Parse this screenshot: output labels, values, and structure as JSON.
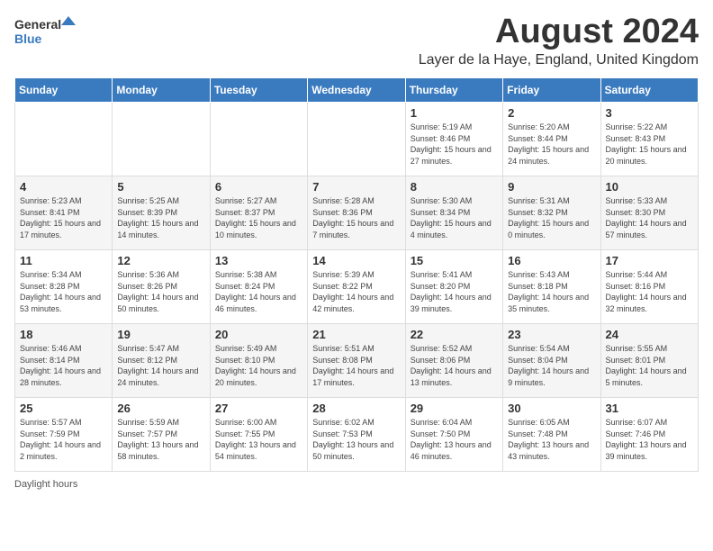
{
  "header": {
    "logo_general": "General",
    "logo_blue": "Blue",
    "month_title": "August 2024",
    "location": "Layer de la Haye, England, United Kingdom"
  },
  "weekdays": [
    "Sunday",
    "Monday",
    "Tuesday",
    "Wednesday",
    "Thursday",
    "Friday",
    "Saturday"
  ],
  "weeks": [
    [
      {
        "day": "",
        "sunrise": "",
        "sunset": "",
        "daylight": ""
      },
      {
        "day": "",
        "sunrise": "",
        "sunset": "",
        "daylight": ""
      },
      {
        "day": "",
        "sunrise": "",
        "sunset": "",
        "daylight": ""
      },
      {
        "day": "",
        "sunrise": "",
        "sunset": "",
        "daylight": ""
      },
      {
        "day": "1",
        "sunrise": "Sunrise: 5:19 AM",
        "sunset": "Sunset: 8:46 PM",
        "daylight": "Daylight: 15 hours and 27 minutes."
      },
      {
        "day": "2",
        "sunrise": "Sunrise: 5:20 AM",
        "sunset": "Sunset: 8:44 PM",
        "daylight": "Daylight: 15 hours and 24 minutes."
      },
      {
        "day": "3",
        "sunrise": "Sunrise: 5:22 AM",
        "sunset": "Sunset: 8:43 PM",
        "daylight": "Daylight: 15 hours and 20 minutes."
      }
    ],
    [
      {
        "day": "4",
        "sunrise": "Sunrise: 5:23 AM",
        "sunset": "Sunset: 8:41 PM",
        "daylight": "Daylight: 15 hours and 17 minutes."
      },
      {
        "day": "5",
        "sunrise": "Sunrise: 5:25 AM",
        "sunset": "Sunset: 8:39 PM",
        "daylight": "Daylight: 15 hours and 14 minutes."
      },
      {
        "day": "6",
        "sunrise": "Sunrise: 5:27 AM",
        "sunset": "Sunset: 8:37 PM",
        "daylight": "Daylight: 15 hours and 10 minutes."
      },
      {
        "day": "7",
        "sunrise": "Sunrise: 5:28 AM",
        "sunset": "Sunset: 8:36 PM",
        "daylight": "Daylight: 15 hours and 7 minutes."
      },
      {
        "day": "8",
        "sunrise": "Sunrise: 5:30 AM",
        "sunset": "Sunset: 8:34 PM",
        "daylight": "Daylight: 15 hours and 4 minutes."
      },
      {
        "day": "9",
        "sunrise": "Sunrise: 5:31 AM",
        "sunset": "Sunset: 8:32 PM",
        "daylight": "Daylight: 15 hours and 0 minutes."
      },
      {
        "day": "10",
        "sunrise": "Sunrise: 5:33 AM",
        "sunset": "Sunset: 8:30 PM",
        "daylight": "Daylight: 14 hours and 57 minutes."
      }
    ],
    [
      {
        "day": "11",
        "sunrise": "Sunrise: 5:34 AM",
        "sunset": "Sunset: 8:28 PM",
        "daylight": "Daylight: 14 hours and 53 minutes."
      },
      {
        "day": "12",
        "sunrise": "Sunrise: 5:36 AM",
        "sunset": "Sunset: 8:26 PM",
        "daylight": "Daylight: 14 hours and 50 minutes."
      },
      {
        "day": "13",
        "sunrise": "Sunrise: 5:38 AM",
        "sunset": "Sunset: 8:24 PM",
        "daylight": "Daylight: 14 hours and 46 minutes."
      },
      {
        "day": "14",
        "sunrise": "Sunrise: 5:39 AM",
        "sunset": "Sunset: 8:22 PM",
        "daylight": "Daylight: 14 hours and 42 minutes."
      },
      {
        "day": "15",
        "sunrise": "Sunrise: 5:41 AM",
        "sunset": "Sunset: 8:20 PM",
        "daylight": "Daylight: 14 hours and 39 minutes."
      },
      {
        "day": "16",
        "sunrise": "Sunrise: 5:43 AM",
        "sunset": "Sunset: 8:18 PM",
        "daylight": "Daylight: 14 hours and 35 minutes."
      },
      {
        "day": "17",
        "sunrise": "Sunrise: 5:44 AM",
        "sunset": "Sunset: 8:16 PM",
        "daylight": "Daylight: 14 hours and 32 minutes."
      }
    ],
    [
      {
        "day": "18",
        "sunrise": "Sunrise: 5:46 AM",
        "sunset": "Sunset: 8:14 PM",
        "daylight": "Daylight: 14 hours and 28 minutes."
      },
      {
        "day": "19",
        "sunrise": "Sunrise: 5:47 AM",
        "sunset": "Sunset: 8:12 PM",
        "daylight": "Daylight: 14 hours and 24 minutes."
      },
      {
        "day": "20",
        "sunrise": "Sunrise: 5:49 AM",
        "sunset": "Sunset: 8:10 PM",
        "daylight": "Daylight: 14 hours and 20 minutes."
      },
      {
        "day": "21",
        "sunrise": "Sunrise: 5:51 AM",
        "sunset": "Sunset: 8:08 PM",
        "daylight": "Daylight: 14 hours and 17 minutes."
      },
      {
        "day": "22",
        "sunrise": "Sunrise: 5:52 AM",
        "sunset": "Sunset: 8:06 PM",
        "daylight": "Daylight: 14 hours and 13 minutes."
      },
      {
        "day": "23",
        "sunrise": "Sunrise: 5:54 AM",
        "sunset": "Sunset: 8:04 PM",
        "daylight": "Daylight: 14 hours and 9 minutes."
      },
      {
        "day": "24",
        "sunrise": "Sunrise: 5:55 AM",
        "sunset": "Sunset: 8:01 PM",
        "daylight": "Daylight: 14 hours and 5 minutes."
      }
    ],
    [
      {
        "day": "25",
        "sunrise": "Sunrise: 5:57 AM",
        "sunset": "Sunset: 7:59 PM",
        "daylight": "Daylight: 14 hours and 2 minutes."
      },
      {
        "day": "26",
        "sunrise": "Sunrise: 5:59 AM",
        "sunset": "Sunset: 7:57 PM",
        "daylight": "Daylight: 13 hours and 58 minutes."
      },
      {
        "day": "27",
        "sunrise": "Sunrise: 6:00 AM",
        "sunset": "Sunset: 7:55 PM",
        "daylight": "Daylight: 13 hours and 54 minutes."
      },
      {
        "day": "28",
        "sunrise": "Sunrise: 6:02 AM",
        "sunset": "Sunset: 7:53 PM",
        "daylight": "Daylight: 13 hours and 50 minutes."
      },
      {
        "day": "29",
        "sunrise": "Sunrise: 6:04 AM",
        "sunset": "Sunset: 7:50 PM",
        "daylight": "Daylight: 13 hours and 46 minutes."
      },
      {
        "day": "30",
        "sunrise": "Sunrise: 6:05 AM",
        "sunset": "Sunset: 7:48 PM",
        "daylight": "Daylight: 13 hours and 43 minutes."
      },
      {
        "day": "31",
        "sunrise": "Sunrise: 6:07 AM",
        "sunset": "Sunset: 7:46 PM",
        "daylight": "Daylight: 13 hours and 39 minutes."
      }
    ]
  ],
  "footer": {
    "note": "Daylight hours"
  }
}
